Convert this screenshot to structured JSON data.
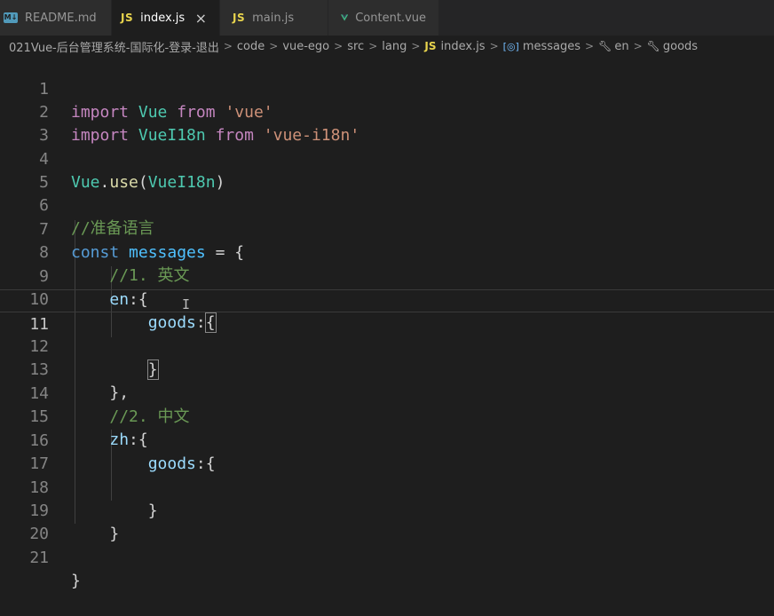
{
  "tabs": [
    {
      "label": "README.md",
      "icon": "markdown-icon",
      "active": false
    },
    {
      "label": "index.js",
      "icon": "js-file-icon",
      "active": true,
      "close": "×"
    },
    {
      "label": "main.js",
      "icon": "js-file-icon",
      "active": false
    },
    {
      "label": "Content.vue",
      "icon": "vue-file-icon",
      "active": false
    }
  ],
  "icons": {
    "md": "M↓",
    "js": "JS",
    "sym": "[◎]",
    "wrench": "🔧︎"
  },
  "breadcrumb": {
    "items": [
      "021Vue-后台管理系统-国际化-登录-退出",
      "code",
      "vue-ego",
      "src",
      "lang",
      "index.js",
      "messages",
      "en",
      "goods"
    ],
    "separator": ">"
  },
  "editor": {
    "current_line": 11,
    "lines": [
      {
        "n": "1"
      },
      {
        "n": "2"
      },
      {
        "n": "3"
      },
      {
        "n": "4"
      },
      {
        "n": "5"
      },
      {
        "n": "6"
      },
      {
        "n": "7"
      },
      {
        "n": "8"
      },
      {
        "n": "9"
      },
      {
        "n": "10"
      },
      {
        "n": "11"
      },
      {
        "n": "12"
      },
      {
        "n": "13"
      },
      {
        "n": "14"
      },
      {
        "n": "15"
      },
      {
        "n": "16"
      },
      {
        "n": "17"
      },
      {
        "n": "18"
      },
      {
        "n": "19"
      },
      {
        "n": "20"
      },
      {
        "n": "21"
      }
    ],
    "tokens": {
      "import": "import",
      "from": "from",
      "const": "const",
      "vue": "Vue",
      "vuei18n": "VueI18n",
      "str_vue": "'vue'",
      "str_vuei18n": "'vue-i18n'",
      "use": "use",
      "dot": ".",
      "lparen": "(",
      "rparen": ")",
      "comment_lang": "//准备语言",
      "messages": "messages",
      "eq": "=",
      "lbrace": "{",
      "rbrace": "}",
      "rbrace_comma": "},",
      "comment_en": "//1. 英文",
      "comment_zh": "//2. 中文",
      "en": "en",
      "zh": "zh",
      "goods": "goods",
      "colon": ":"
    }
  }
}
